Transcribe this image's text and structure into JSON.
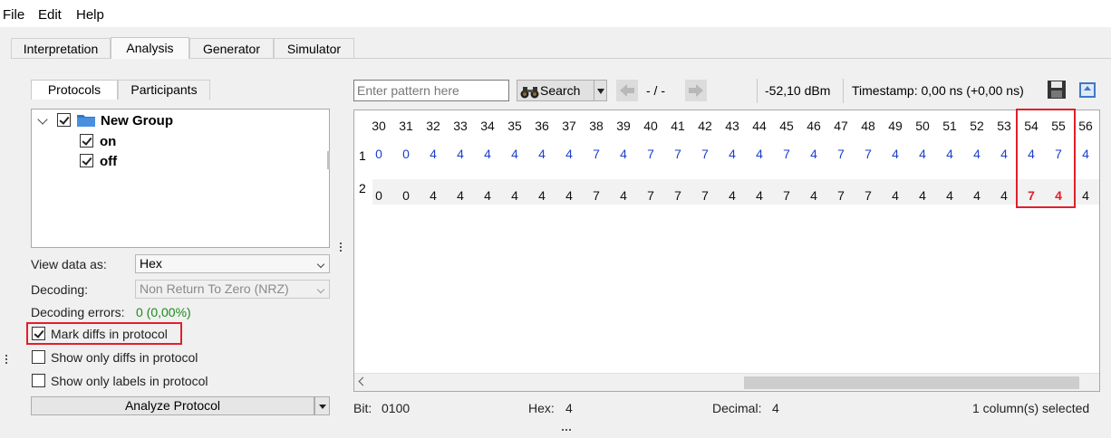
{
  "menu": {
    "file": "File",
    "edit": "Edit",
    "help": "Help"
  },
  "tabs": [
    "Interpretation",
    "Analysis",
    "Generator",
    "Simulator"
  ],
  "left_panel": {
    "subtabs": [
      "Protocols",
      "Participants"
    ],
    "tree": {
      "group": "New Group",
      "items": [
        "on",
        "off"
      ]
    },
    "view_data_as_label": "View data as:",
    "view_data_as_value": "Hex",
    "decoding_label": "Decoding:",
    "decoding_value": "Non Return To Zero (NRZ)",
    "decoding_errors_label": "Decoding errors:",
    "decoding_errors_value": "0 (0,00%)",
    "decoding_errors_color": "#1a8a1a",
    "mark_diffs": "Mark diffs in protocol",
    "show_only_diffs": "Show only diffs in protocol",
    "show_only_labels": "Show only labels in protocol",
    "analyze_button": "Analyze Protocol"
  },
  "toolbar": {
    "pattern_placeholder": "Enter pattern here",
    "search_label": "Search",
    "nav_position": "- / -",
    "rssi": "-52,10 dBm",
    "timestamp": "Timestamp: 0,00 ns (+0,00 ns)",
    "icons": [
      "binoculars-icon",
      "arrow-left-icon",
      "arrow-right-icon",
      "save-icon",
      "export-icon"
    ]
  },
  "table": {
    "columns": [
      "30",
      "31",
      "32",
      "33",
      "34",
      "35",
      "36",
      "37",
      "38",
      "39",
      "40",
      "41",
      "42",
      "43",
      "44",
      "45",
      "46",
      "47",
      "48",
      "49",
      "50",
      "51",
      "52",
      "53",
      "54",
      "55",
      "56"
    ],
    "rows": [
      {
        "label": "1",
        "values": [
          "0",
          "0",
          "4",
          "4",
          "4",
          "4",
          "4",
          "4",
          "7",
          "4",
          "7",
          "7",
          "7",
          "4",
          "4",
          "7",
          "4",
          "7",
          "7",
          "4",
          "4",
          "4",
          "4",
          "4",
          "4",
          "7",
          "4"
        ]
      },
      {
        "label": "2",
        "values": [
          "0",
          "0",
          "4",
          "4",
          "4",
          "4",
          "4",
          "4",
          "7",
          "4",
          "7",
          "7",
          "7",
          "4",
          "4",
          "7",
          "4",
          "7",
          "7",
          "4",
          "4",
          "4",
          "4",
          "4",
          "7",
          "4",
          "4"
        ]
      }
    ],
    "diff_columns": [
      "54",
      "55"
    ],
    "colors": {
      "row1_text": "#1b3fcc",
      "diff": "#e0202a"
    }
  },
  "status": {
    "bit_label": "Bit:",
    "bit_value": "0100",
    "hex_label": "Hex:",
    "hex_value": "4",
    "decimal_label": "Decimal:",
    "decimal_value": "4",
    "selection": "1 column(s) selected"
  }
}
